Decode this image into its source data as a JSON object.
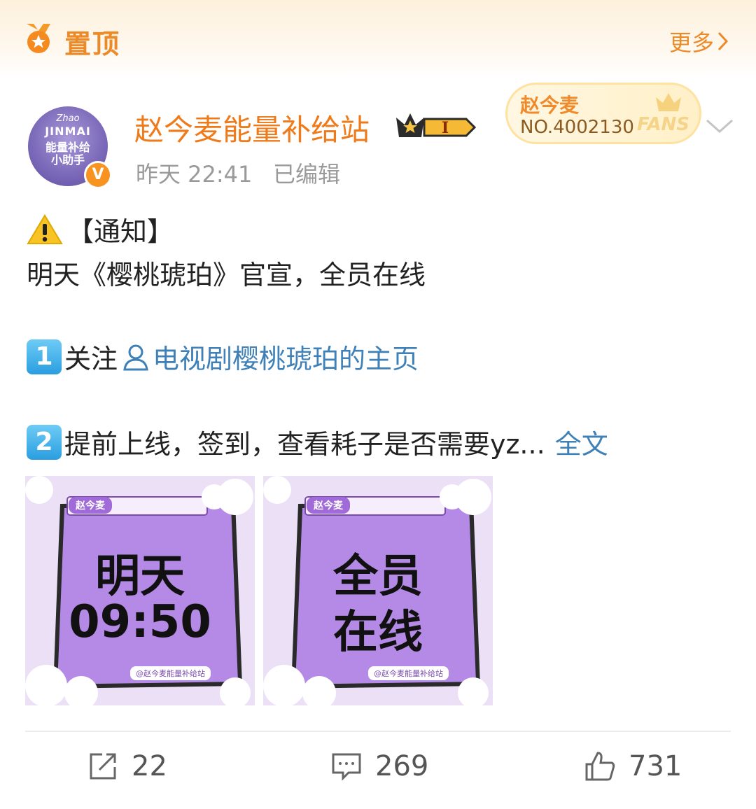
{
  "pin": {
    "label": "置顶",
    "more": "更多"
  },
  "user": {
    "name": "赵今麦能量补给站",
    "time": "昨天 22:41",
    "edited": "已编辑",
    "avatar_text": {
      "line1": "Zhao",
      "line2": "JINMAI",
      "line3a": "能量补给",
      "line3b": "小助手"
    },
    "verified_mark": "V",
    "level_badge": "I"
  },
  "fans_card": {
    "name": "赵今麦",
    "number": "NO.4002130",
    "tag": "FANS"
  },
  "post": {
    "notice": "【通知】",
    "line2": "明天《樱桃琥珀》官宣，全员在线",
    "item1_num": "1",
    "item1_text": "关注",
    "item1_link": "电视剧樱桃琥珀的主页",
    "item2_num": "2",
    "item2_text": "提前上线，签到，查看耗子是否需要yz...",
    "full_text": "全文"
  },
  "images": [
    {
      "tag": "赵今麦",
      "line1": "明天",
      "line2": "09:50",
      "footer": "@赵今麦能量补给站"
    },
    {
      "tag": "赵今麦",
      "line1": "全员",
      "line2": "在线",
      "footer": "@赵今麦能量补给站"
    }
  ],
  "actions": {
    "repost": "22",
    "comment": "269",
    "like": "731"
  },
  "icons": [
    "medal-icon",
    "chevron-right-icon",
    "crown-badge-icon",
    "chevron-down-icon",
    "warning-icon",
    "person-icon",
    "repost-icon",
    "comment-icon",
    "like-icon"
  ],
  "colors": {
    "accent_orange": "#ef7a1a",
    "link_blue": "#3f80b7",
    "tile_purple": "#b48ae6"
  }
}
